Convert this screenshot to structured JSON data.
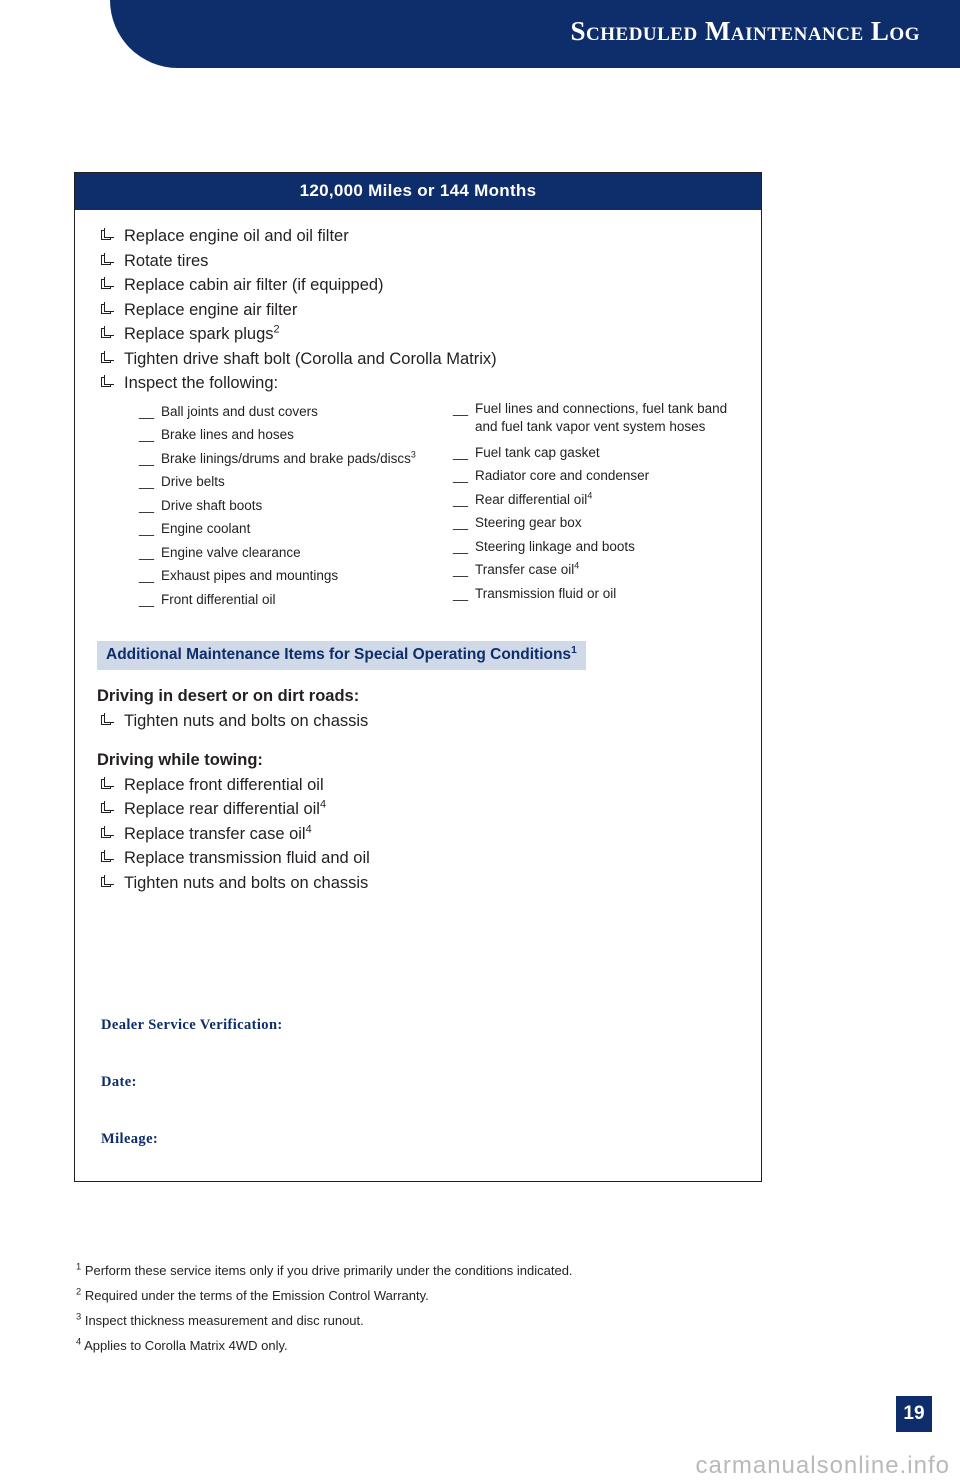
{
  "header": {
    "title": "Scheduled Maintenance Log"
  },
  "box": {
    "title": "120,000 Miles or 144 Months",
    "main_items": [
      {
        "text": "Replace engine oil and oil filter",
        "sup": ""
      },
      {
        "text": "Rotate tires",
        "sup": ""
      },
      {
        "text": "Replace cabin air filter (if equipped)",
        "sup": ""
      },
      {
        "text": "Replace engine air filter",
        "sup": ""
      },
      {
        "text": "Replace spark plugs",
        "sup": "2"
      },
      {
        "text": "Tighten drive shaft bolt (Corolla and Corolla Matrix)",
        "sup": ""
      },
      {
        "text": "Inspect the following:",
        "sup": ""
      }
    ],
    "inspect_left": [
      {
        "text": "Ball joints and dust covers",
        "sup": ""
      },
      {
        "text": "Brake lines and hoses",
        "sup": ""
      },
      {
        "text": "Brake linings/drums and brake pads/discs",
        "sup": "3"
      },
      {
        "text": "Drive belts",
        "sup": ""
      },
      {
        "text": "Drive shaft boots",
        "sup": ""
      },
      {
        "text": "Engine coolant",
        "sup": ""
      },
      {
        "text": "Engine valve clearance",
        "sup": ""
      },
      {
        "text": "Exhaust pipes and mountings",
        "sup": ""
      },
      {
        "text": "Front differential oil",
        "sup": ""
      }
    ],
    "inspect_right": [
      {
        "text": "Fuel lines and connections, fuel tank band and fuel tank vapor vent system hoses",
        "sup": ""
      },
      {
        "text": "Fuel tank cap gasket",
        "sup": ""
      },
      {
        "text": "Radiator core and condenser",
        "sup": ""
      },
      {
        "text": "Rear differential oil",
        "sup": "4"
      },
      {
        "text": "Steering gear box",
        "sup": ""
      },
      {
        "text": "Steering linkage and boots",
        "sup": ""
      },
      {
        "text": "Transfer case oil",
        "sup": "4"
      },
      {
        "text": "Transmission fluid or oil",
        "sup": ""
      }
    ],
    "special": {
      "header_text": "Additional Maintenance Items for Special Operating Conditions",
      "header_sup": "1",
      "group1_title": "Driving in desert or on dirt roads:",
      "group1_items": [
        {
          "text": "Tighten nuts and bolts on chassis",
          "sup": ""
        }
      ],
      "group2_title": "Driving while towing:",
      "group2_items": [
        {
          "text": "Replace front differential oil",
          "sup": ""
        },
        {
          "text": "Replace rear differential oil",
          "sup": "4"
        },
        {
          "text": "Replace transfer case oil",
          "sup": "4"
        },
        {
          "text": "Replace transmission fluid and oil",
          "sup": ""
        },
        {
          "text": "Tighten nuts and bolts on chassis",
          "sup": ""
        }
      ]
    },
    "verification": {
      "dealer_label": "Dealer Service Verification:",
      "date_label": "Date:",
      "mileage_label": "Mileage:"
    }
  },
  "footnotes": [
    {
      "marker": "1",
      "text": "Perform these service items only if you drive primarily under the conditions indicated."
    },
    {
      "marker": "2",
      "text": "Required under the terms of the Emission Control Warranty."
    },
    {
      "marker": "3",
      "text": "Inspect thickness measurement and disc runout."
    },
    {
      "marker": "4",
      "text": "Applies to Corolla Matrix 4WD only."
    }
  ],
  "page_number": "19",
  "watermark": "carmanualsonline.info",
  "colors": {
    "brand_blue": "#0e2d6b",
    "light_blue": "#cfd9e8",
    "text": "#231f20"
  }
}
